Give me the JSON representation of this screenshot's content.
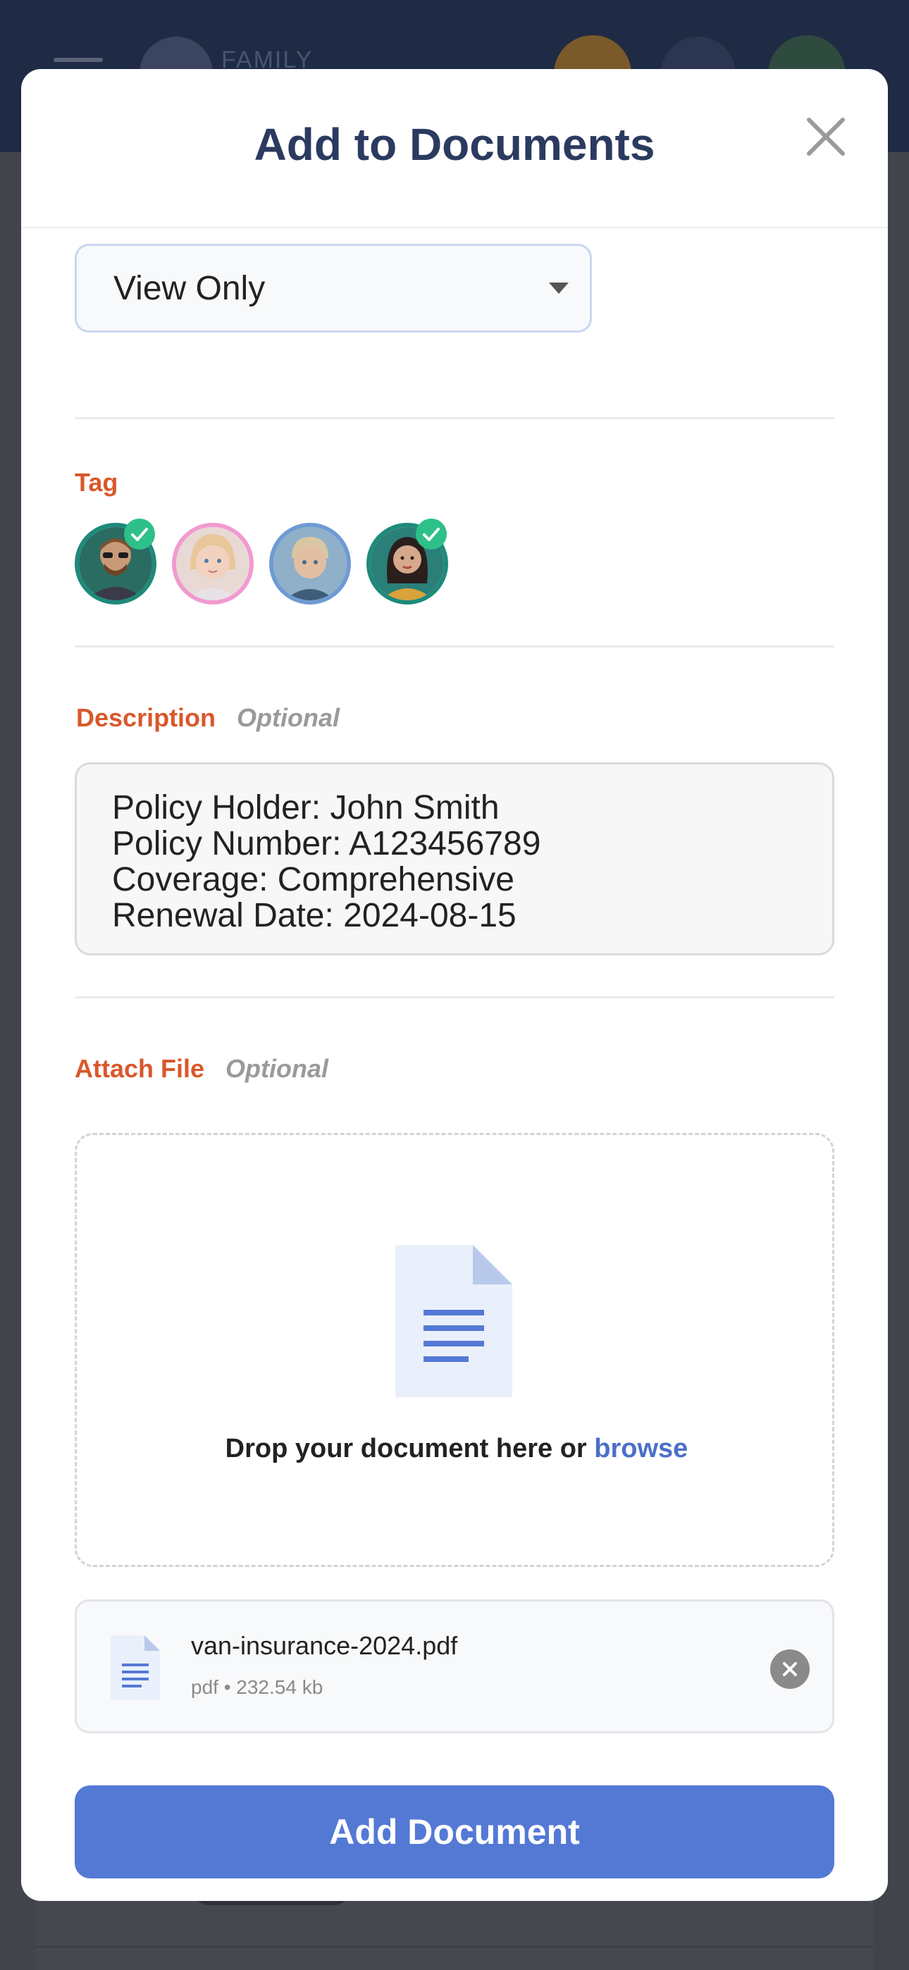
{
  "background": {
    "brand_text": "FAMILY"
  },
  "modal": {
    "title": "Add to Documents",
    "close_icon": "close-icon"
  },
  "permission": {
    "selected": "View Only",
    "caret_icon": "caret-down-icon"
  },
  "tag": {
    "label": "Tag",
    "members": [
      {
        "avatar": "person-avatar",
        "selected": true,
        "ring_color": "#1e8a7a"
      },
      {
        "avatar": "person-avatar",
        "selected": false,
        "ring_color": "#f19ad0"
      },
      {
        "avatar": "person-avatar",
        "selected": false,
        "ring_color": "#6f9ad3"
      },
      {
        "avatar": "person-avatar",
        "selected": true,
        "ring_color": "#1e8a7a"
      }
    ]
  },
  "description": {
    "label": "Description",
    "optional": "Optional",
    "lines": [
      "Policy Holder: John Smith",
      "Policy Number: A123456789",
      "Coverage: Comprehensive",
      "Renewal Date: 2024-08-15"
    ]
  },
  "attach": {
    "label": "Attach File",
    "optional": "Optional",
    "drop_text": "Drop your document here or ",
    "browse_text": "browse",
    "file": {
      "name": "van-insurance-2024.pdf",
      "meta": "pdf • 232.54 kb"
    }
  },
  "submit": {
    "label": "Add Document"
  },
  "colors": {
    "accent": "#5479d5",
    "label": "#d9582b",
    "title": "#2b3a5f",
    "check": "#2ec08a"
  }
}
